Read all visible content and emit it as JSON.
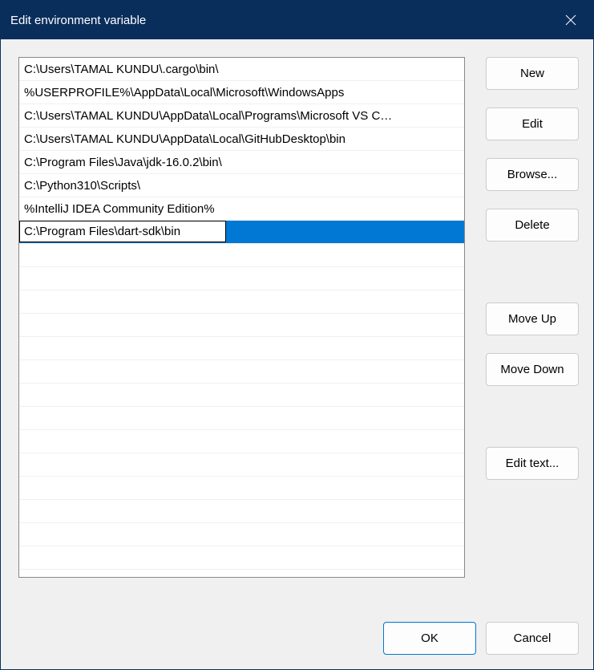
{
  "title": "Edit environment variable",
  "entries": [
    "C:\\Users\\TAMAL KUNDU\\.cargo\\bin\\",
    "%USERPROFILE%\\AppData\\Local\\Microsoft\\WindowsApps",
    "C:\\Users\\TAMAL KUNDU\\AppData\\Local\\Programs\\Microsoft VS C…",
    "C:\\Users\\TAMAL KUNDU\\AppData\\Local\\GitHubDesktop\\bin",
    "C:\\Program Files\\Java\\jdk-16.0.2\\bin\\",
    "C:\\Python310\\Scripts\\",
    "%IntelliJ IDEA Community Edition%",
    "C:\\Program Files\\dart-sdk\\bin"
  ],
  "selected_index": 7,
  "editing_index": 7,
  "buttons": {
    "new": "New",
    "edit": "Edit",
    "browse": "Browse...",
    "delete": "Delete",
    "move_up": "Move Up",
    "move_down": "Move Down",
    "edit_text": "Edit text...",
    "ok": "OK",
    "cancel": "Cancel"
  }
}
